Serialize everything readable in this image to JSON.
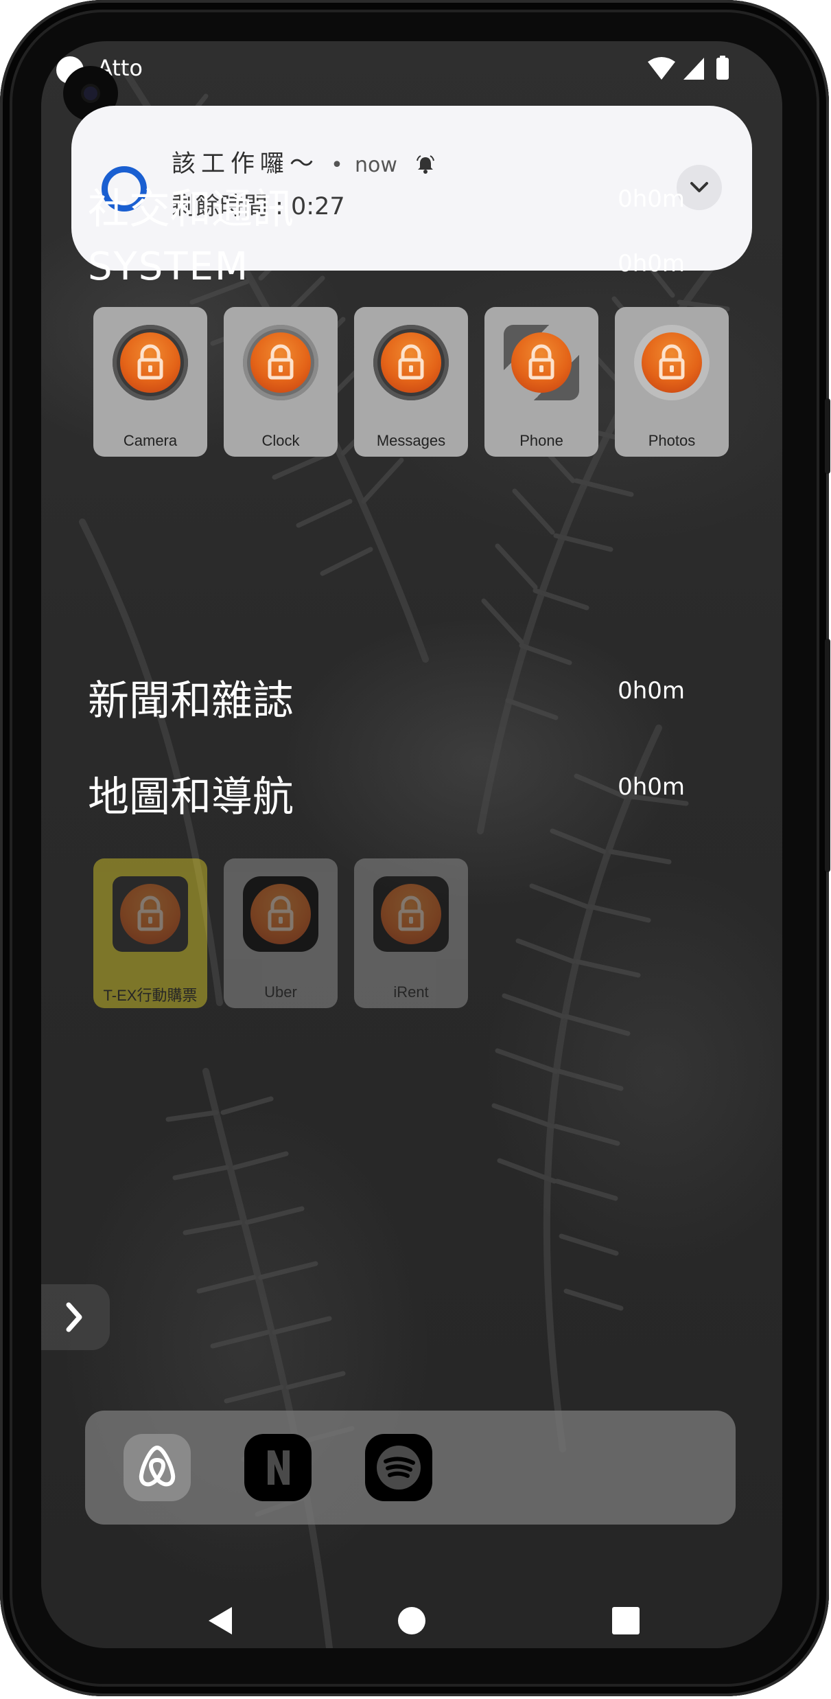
{
  "status_bar": {
    "app_name": "Atto"
  },
  "notification": {
    "title": "該工作囉～",
    "separator": "•",
    "time": "now",
    "body": "剩餘時間 : 0:27"
  },
  "categories": [
    {
      "name": "社交和通訊",
      "time": "0h0m"
    },
    {
      "name": "SYSTEM",
      "time": "0h0m"
    },
    {
      "name": "新聞和雜誌",
      "time": "0h0m"
    },
    {
      "name": "地圖和導航",
      "time": "0h0m"
    }
  ],
  "system_apps": [
    {
      "label": "Camera",
      "icon": "camera-icon"
    },
    {
      "label": "Clock",
      "icon": "clock-icon"
    },
    {
      "label": "Messages",
      "icon": "messages-icon"
    },
    {
      "label": "Phone",
      "icon": "phone-icon"
    },
    {
      "label": "Photos",
      "icon": "photos-icon"
    }
  ],
  "map_apps": [
    {
      "label": "T-EX行動購票",
      "icon": "tex-icon"
    },
    {
      "label": "Uber",
      "icon": "uber-icon"
    },
    {
      "label": "iRent",
      "icon": "irent-icon"
    }
  ],
  "dock": [
    {
      "icon": "airbnb-icon"
    },
    {
      "icon": "netflix-icon"
    },
    {
      "icon": "spotify-icon"
    }
  ],
  "colors": {
    "accent_blue": "#1a5fd1",
    "lock_orange": "#e46418",
    "tex_yellow": "#f2e02a"
  }
}
